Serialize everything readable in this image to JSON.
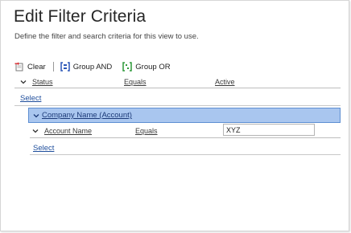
{
  "header": {
    "title": "Edit Filter Criteria",
    "subtitle": "Define the filter and search criteria for this view to use."
  },
  "toolbar": {
    "clear_label": "Clear",
    "group_and_label": "Group AND",
    "group_or_label": "Group OR"
  },
  "filter_rows": [
    {
      "field": "Status",
      "operator": "Equals",
      "value": "Active"
    }
  ],
  "select_link": "Select",
  "group": {
    "label": "Company Name (Account)",
    "rows": [
      {
        "field": "Account Name",
        "operator": "Equals",
        "value": "XYZ"
      }
    ],
    "select_link": "Select"
  },
  "colors": {
    "group_header_bg": "#a9c6ef",
    "group_header_border": "#5e8fd2",
    "link": "#1f4e9c"
  }
}
